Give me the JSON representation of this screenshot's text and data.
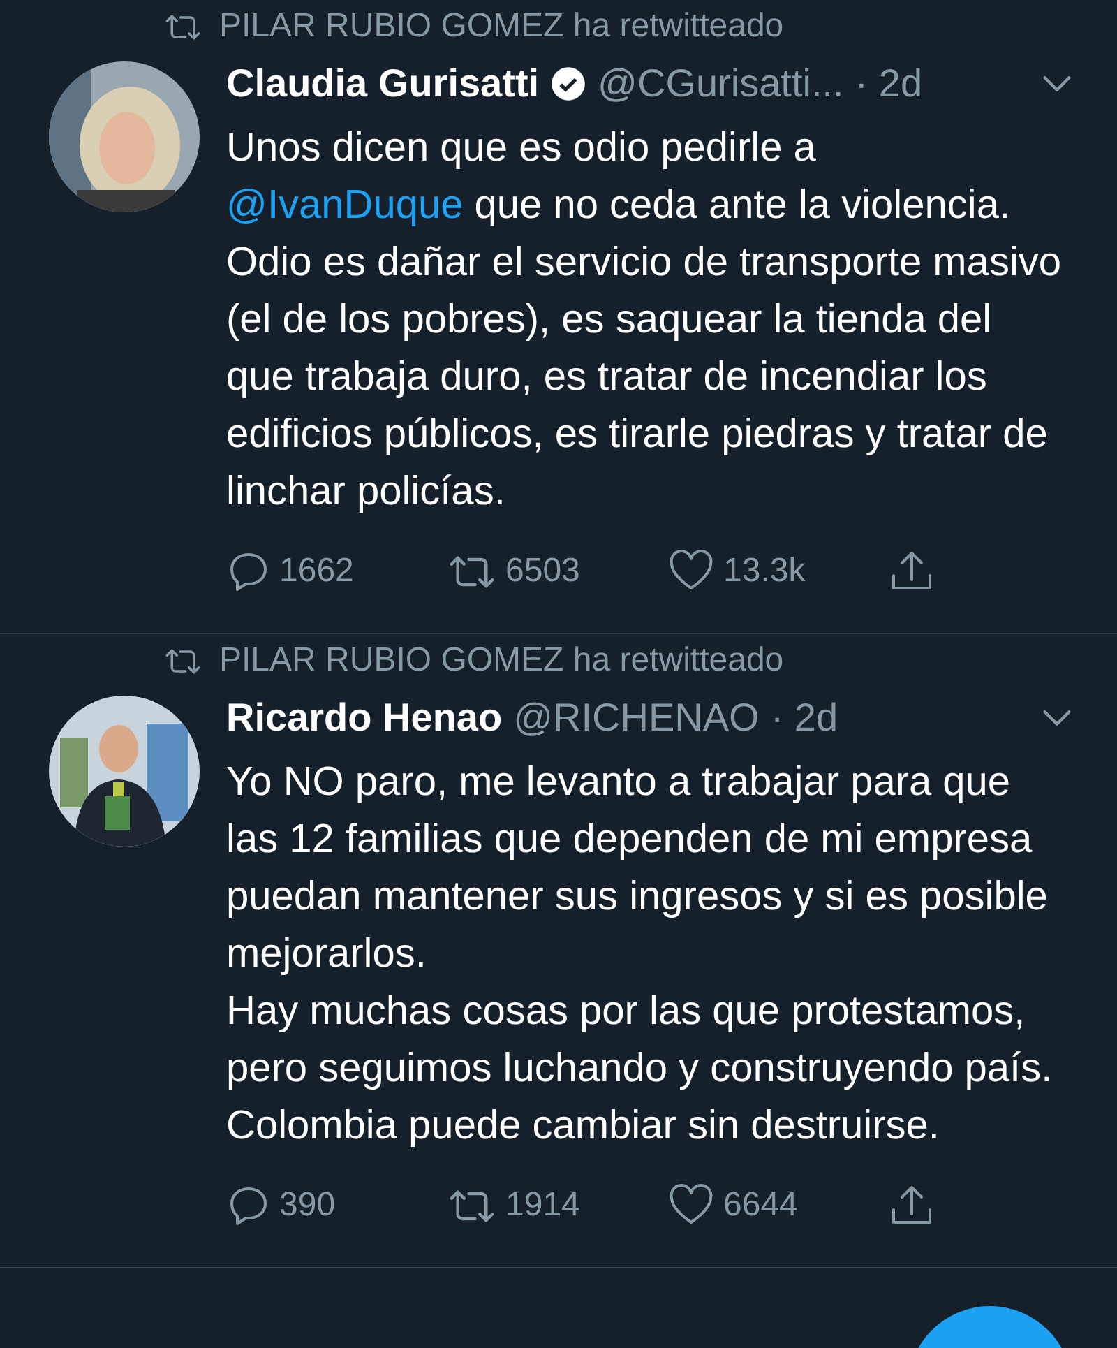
{
  "tweets": [
    {
      "retweeted_by": "PILAR RUBIO GOMEZ ha retwitteado",
      "avatar": {
        "kind": "picture"
      },
      "name": "Claudia Gurisatti",
      "verified": true,
      "handle": "@CGurisatti...",
      "time": "· 2d",
      "body": [
        {
          "kind": "text",
          "text": "Unos dicen que es odio pedirle a "
        },
        {
          "kind": "mention",
          "text": "@IvanDuque"
        },
        {
          "kind": "text",
          "text": " que no ceda ante la violencia. Odio es dañar el servicio de transporte masivo (el de los pobres), es saquear la tienda del que trabaja duro, es tratar de incendiar los edificios públicos, es tirarle piedras y tratar de linchar policías."
        }
      ],
      "replies": "1662",
      "retweets": "6503",
      "likes": "13.3k"
    },
    {
      "retweeted_by": "PILAR RUBIO GOMEZ ha retwitteado",
      "avatar": {
        "kind": "picture"
      },
      "name": "Ricardo Henao",
      "verified": false,
      "handle": "@RICHENAO",
      "time": "· 2d",
      "body": [
        {
          "kind": "text",
          "text": "Yo NO paro, me levanto a trabajar para que las 12 familias que dependen de mi empresa puedan mantener sus ingresos y si es posible mejorarlos.\nHay muchas cosas por las que protestamos, pero seguimos luchando y construyendo país.\nColombia puede cambiar sin destruirse."
        }
      ],
      "replies": "390",
      "retweets": "1914",
      "likes": "6644"
    }
  ]
}
